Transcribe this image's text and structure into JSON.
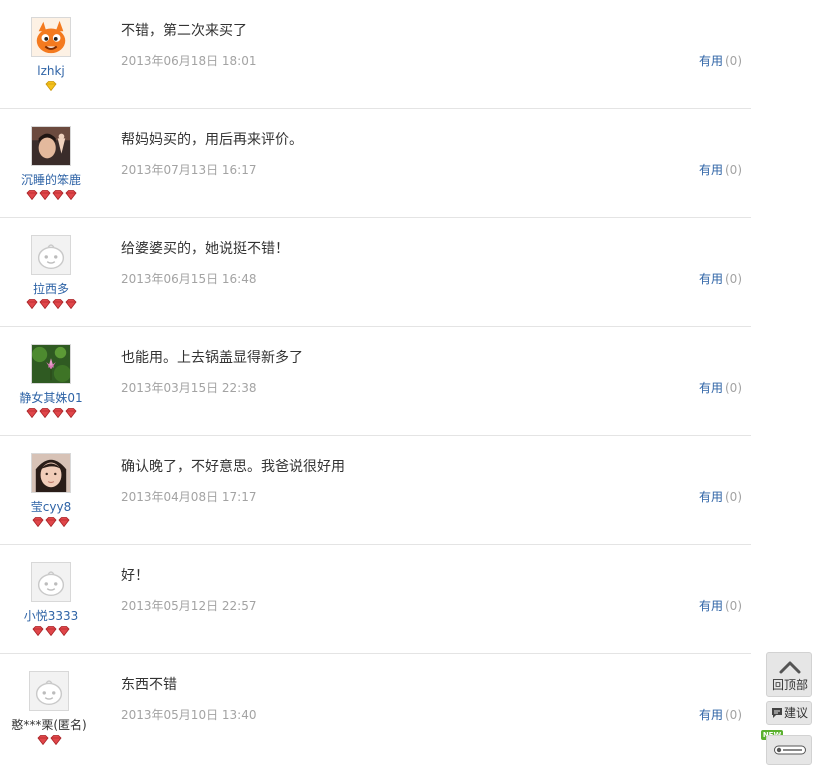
{
  "reviews": [
    {
      "user": "lzhkj",
      "avatar": "orange-cartoon-avatar",
      "badge_icon": "gold-diamond-icon",
      "badges": 1,
      "content": "不错，第二次来买了",
      "time": "2013年06月18日 18:01",
      "useful_label": "有用",
      "useful_count": "(0)"
    },
    {
      "user": "沉睡的笨鹿",
      "avatar": "photo-avatar",
      "badge_icon": "red-heart-gem-icon",
      "badges": 4,
      "content": "帮妈妈买的，用后再来评价。",
      "time": "2013年07月13日 16:17",
      "useful_label": "有用",
      "useful_count": "(0)"
    },
    {
      "user": "拉西多",
      "avatar": "default-avatar",
      "badge_icon": "red-heart-gem-icon",
      "badges": 4,
      "content": "给婆婆买的，她说挺不错！",
      "time": "2013年06月15日 16:48",
      "useful_label": "有用",
      "useful_count": "(0)"
    },
    {
      "user": "静女其姝01",
      "avatar": "flower-photo-avatar",
      "badge_icon": "red-heart-gem-icon",
      "badges": 4,
      "content": "也能用。上去锅盖显得新多了",
      "time": "2013年03月15日 22:38",
      "useful_label": "有用",
      "useful_count": "(0)"
    },
    {
      "user": "莹cyy8",
      "avatar": "face-photo-avatar",
      "badge_icon": "red-heart-gem-icon",
      "badges": 3,
      "content": "确认晚了，不好意思。我爸说很好用",
      "time": "2013年04月08日 17:17",
      "useful_label": "有用",
      "useful_count": "(0)"
    },
    {
      "user": "小悦3333",
      "avatar": "default-avatar",
      "badge_icon": "red-heart-gem-icon",
      "badges": 3,
      "content": "好！",
      "time": "2013年05月12日 22:57",
      "useful_label": "有用",
      "useful_count": "(0)"
    },
    {
      "user": "憨***栗(匿名)",
      "avatar": "default-avatar",
      "badge_icon": "red-heart-gem-icon",
      "badges": 2,
      "content": "东西不错",
      "time": "2013年05月10日 13:40",
      "useful_label": "有用",
      "useful_count": "(0)"
    }
  ],
  "sidebar": {
    "back_to_top": "回顶部",
    "suggest": "建议",
    "new_badge": "NEW"
  },
  "colors": {
    "link": "#2e63a6",
    "muted": "#a3a3a3",
    "divider": "#e4e4e4",
    "gem_red": "#e0464a",
    "gem_gold": "#f5c21b"
  }
}
